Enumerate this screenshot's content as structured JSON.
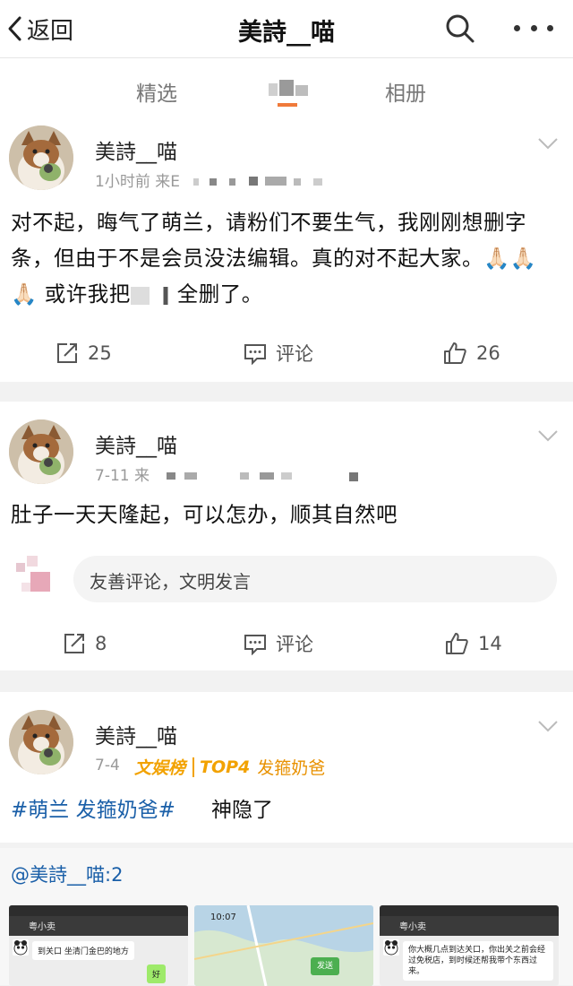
{
  "header": {
    "back_label": "返回",
    "title": "美詩__喵"
  },
  "tabs": {
    "left": "精选",
    "right": "相册"
  },
  "posts": [
    {
      "username": "美詩__喵",
      "meta_visible": "1小时前  来E",
      "text": "对不起，晦气了萌兰，请粉们不要生气，我刚刚想删字条，但由于不是会员没法编辑。真的对不起大家。🙏🏻🙏🏻🙏🏻 或许我把",
      "text_tail": "全删了。",
      "repost_count": "25",
      "comment_label": "评论",
      "like_count": "26"
    },
    {
      "username": "美詩__喵",
      "meta_visible": "7-11  来",
      "text": "肚子一天天隆起，可以怎办，顺其自然吧",
      "comment_placeholder": "友善评论，文明发言",
      "repost_count": "8",
      "comment_label": "评论",
      "like_count": "14"
    },
    {
      "username": "美詩__喵",
      "date": "7-4",
      "badge_1": "文娱榜",
      "badge_2": "TOP4",
      "badge_3": "发箍奶爸",
      "topic": "#萌兰 发箍奶爸#",
      "topic_after": "神隐了"
    }
  ],
  "repost_block": {
    "mention": "@美詩__喵:2",
    "thumb_1_chat": "粤小卖",
    "thumb_1_msg": "到关口 坐清门金巴的地方",
    "thumb_1_reply": "好",
    "thumb_2_time": "10:07",
    "thumb_2_btn": "发送",
    "thumb_3_chat": "粤小卖",
    "thumb_3_msg": "你大概几点到达关口，你出关之前会经过免税店，到时候还帮我带个东西过来。"
  },
  "colors": {
    "link": "#1a5fa8",
    "badge": "#f2a200",
    "bg": "#f2f2f2"
  }
}
